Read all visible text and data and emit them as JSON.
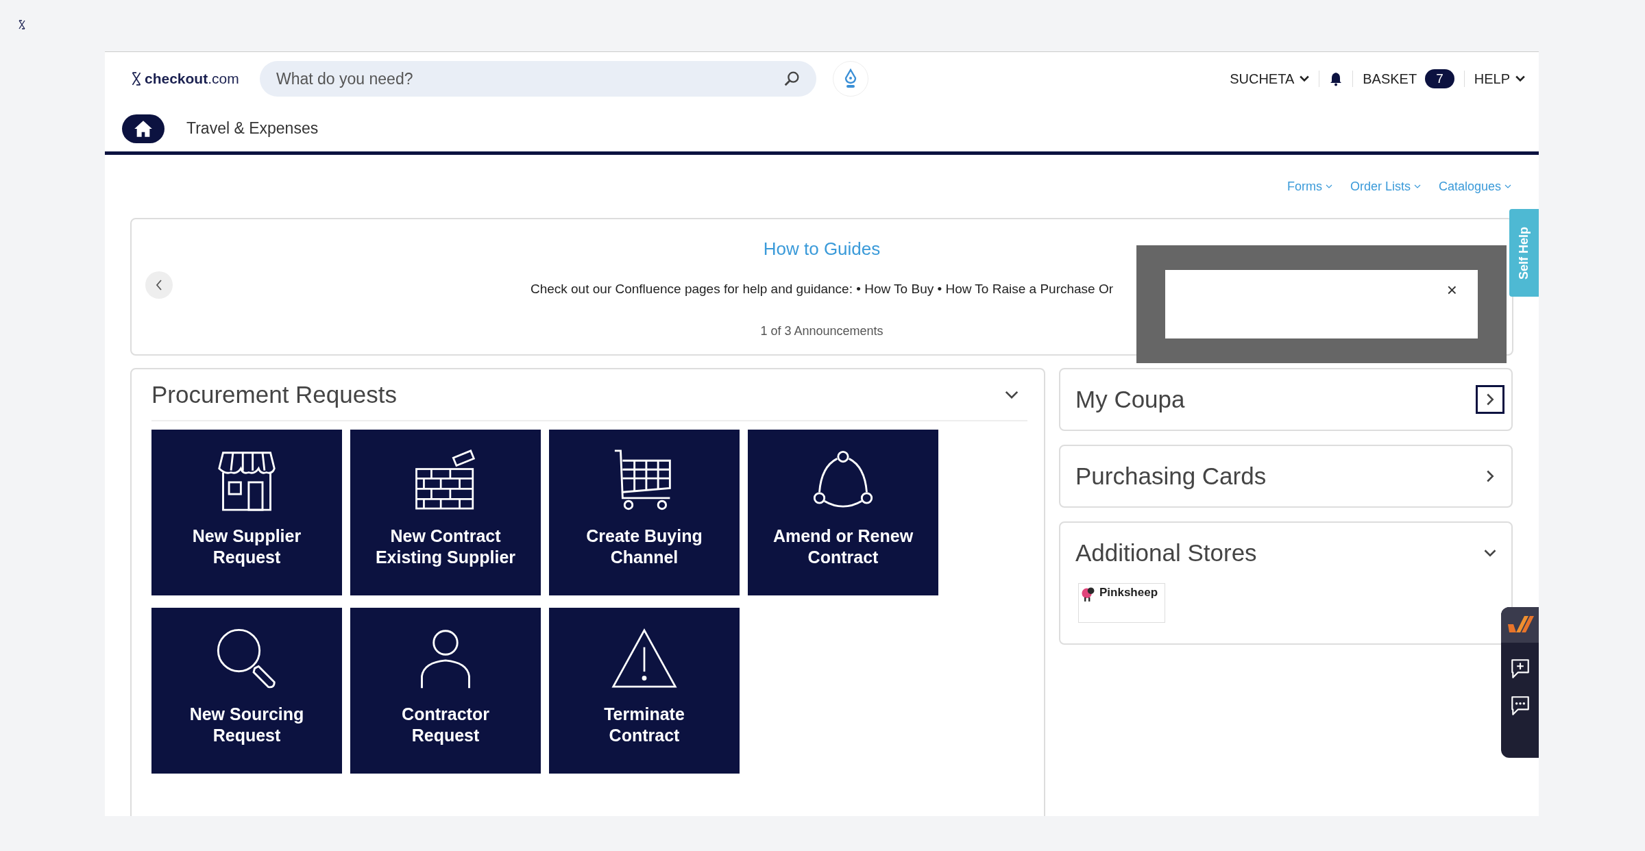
{
  "header": {
    "logo": {
      "brand": "checkout",
      "suffix": ".com"
    },
    "search": {
      "placeholder": "What do you need?"
    },
    "user_menu": "SUCHETA",
    "basket": {
      "label": "BASKET",
      "count": "7"
    },
    "help": "HELP"
  },
  "nav": {
    "items": [
      {
        "label": "Travel & Expenses"
      }
    ]
  },
  "quick_links": [
    {
      "label": "Forms"
    },
    {
      "label": "Order Lists"
    },
    {
      "label": "Catalogues"
    }
  ],
  "announcement": {
    "title": "How to Guides",
    "body": "Check out our Confluence pages for help and guidance: • How To Buy • How To Raise a Purchase Or",
    "counter": "1 of 3 Announcements"
  },
  "procurement": {
    "title": "Procurement Requests",
    "expanded": true,
    "tiles": [
      {
        "kind": "store",
        "label": "New Supplier\nRequest"
      },
      {
        "kind": "wall",
        "label": "New Contract\nExisting Supplier"
      },
      {
        "kind": "cart",
        "label": "Create Buying\nChannel"
      },
      {
        "kind": "cycle",
        "label": "Amend or Renew\nContract"
      },
      {
        "kind": "search",
        "label": "New Sourcing\nRequest"
      },
      {
        "kind": "person",
        "label": "Contractor\nRequest"
      },
      {
        "kind": "warning",
        "label": "Terminate\nContract"
      }
    ]
  },
  "side_panels": [
    {
      "title": "My Coupa",
      "expanded": false,
      "focused": true
    },
    {
      "title": "Purchasing Cards",
      "expanded": false,
      "focused": false
    },
    {
      "title": "Additional Stores",
      "expanded": true,
      "focused": false,
      "stores": [
        {
          "name": "Pinksheep"
        }
      ]
    }
  ],
  "dialog": {
    "close": "×"
  },
  "self_help": {
    "label": "Self Help"
  }
}
